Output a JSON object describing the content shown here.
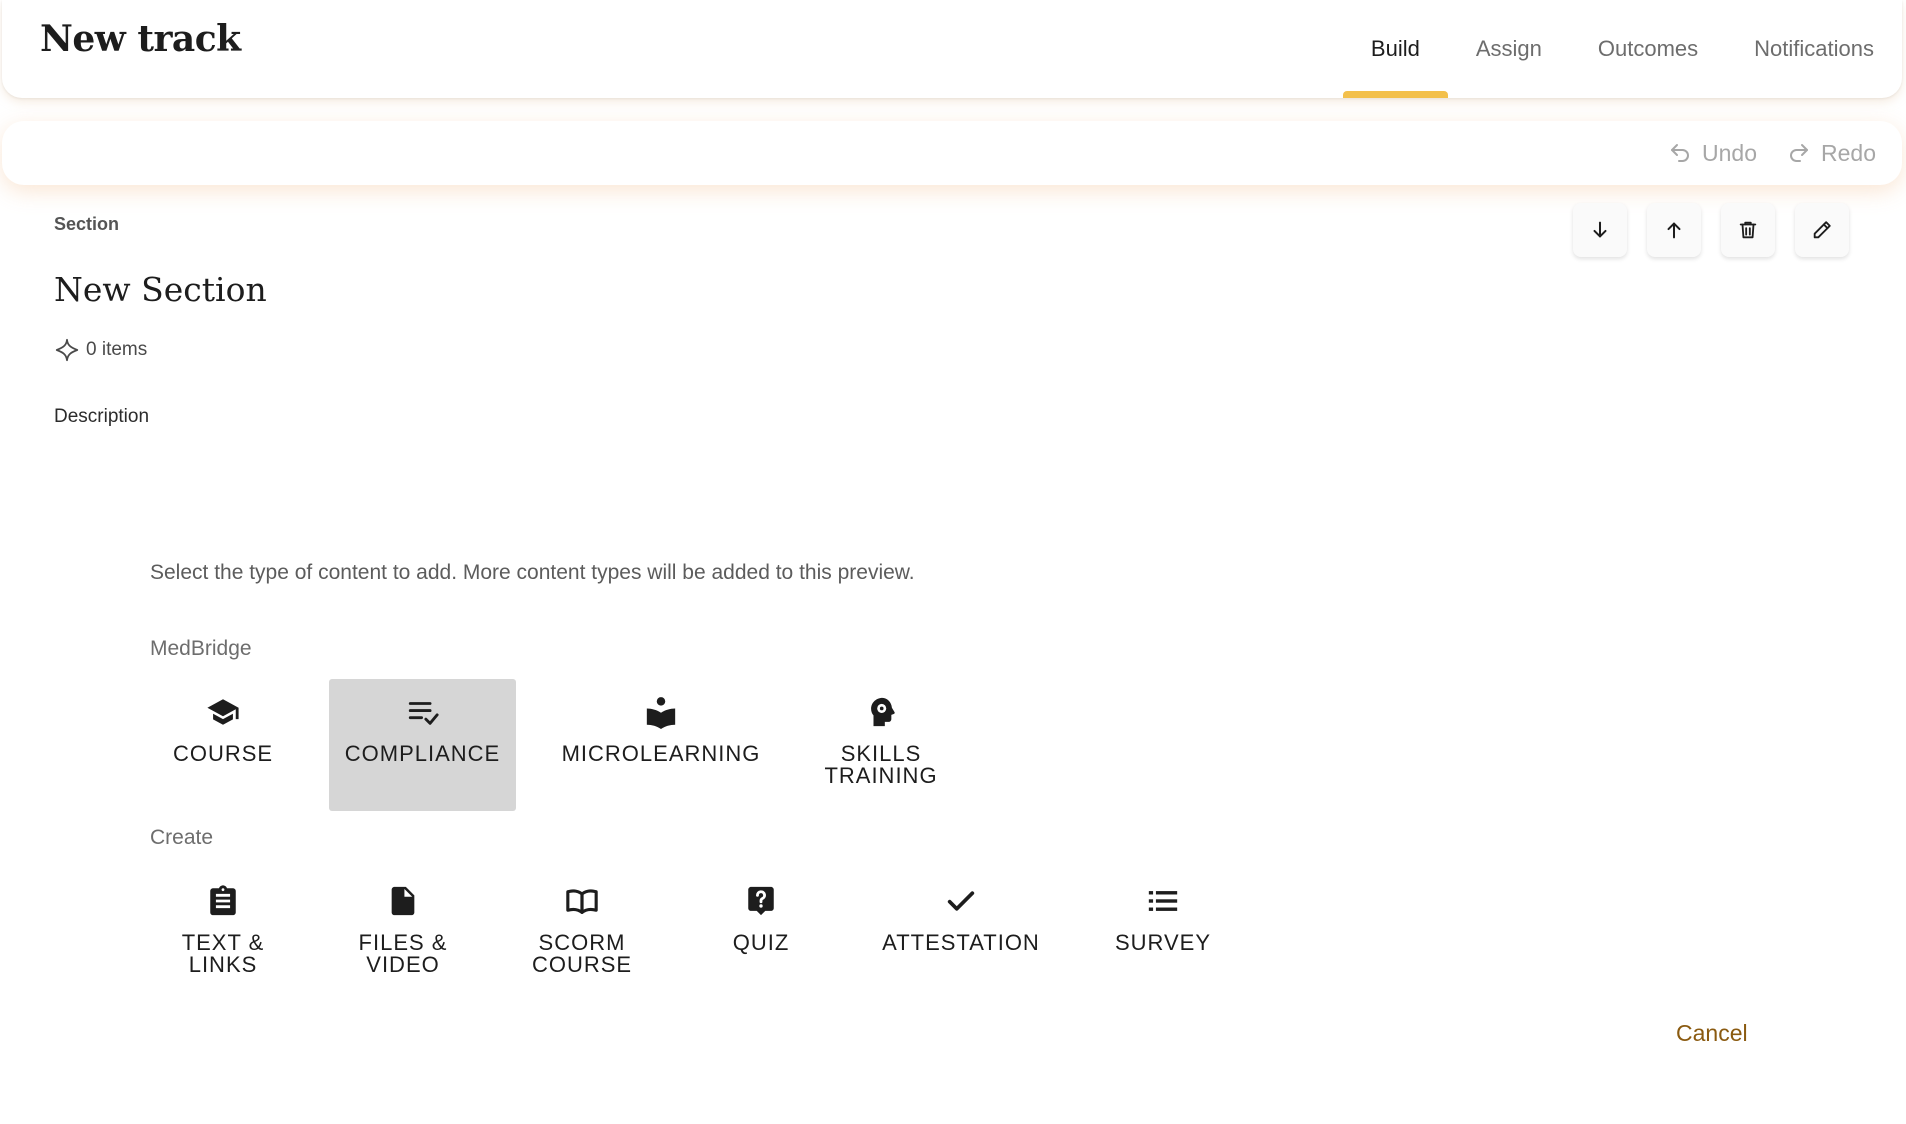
{
  "header": {
    "title": "New track",
    "tabs": [
      {
        "label": "Build",
        "active": true
      },
      {
        "label": "Assign",
        "active": false
      },
      {
        "label": "Outcomes",
        "active": false
      },
      {
        "label": "Notifications",
        "active": false
      }
    ]
  },
  "toolbar": {
    "undo_label": "Undo",
    "redo_label": "Redo"
  },
  "section": {
    "label": "Section",
    "title": "New Section",
    "items_count": "0 items",
    "description_label": "Description"
  },
  "picker": {
    "instructions": "Select the type of content to add. More content types will be added to this preview.",
    "groups": [
      {
        "label": "MedBridge",
        "items": [
          {
            "label": "COURSE",
            "icon": "graduation-cap-icon"
          },
          {
            "label": "COMPLIANCE",
            "icon": "checklist-icon",
            "selected": true
          },
          {
            "label": "MICROLEARNING",
            "icon": "reading-person-icon"
          },
          {
            "label": "SKILLS TRAINING",
            "icon": "head-gear-icon"
          }
        ]
      },
      {
        "label": "Create",
        "items": [
          {
            "label": "TEXT & LINKS",
            "icon": "clipboard-icon"
          },
          {
            "label": "FILES & VIDEO",
            "icon": "file-icon"
          },
          {
            "label": "SCORM COURSE",
            "icon": "open-book-icon"
          },
          {
            "label": "QUIZ",
            "icon": "question-icon"
          },
          {
            "label": "ATTESTATION",
            "icon": "checkmark-icon"
          },
          {
            "label": "SURVEY",
            "icon": "list-icon"
          }
        ]
      }
    ],
    "cancel_label": "Cancel"
  },
  "colors": {
    "accent": "#f3c04b",
    "cancel": "#8a5a10",
    "selected_tile": "#d6d6d6"
  }
}
